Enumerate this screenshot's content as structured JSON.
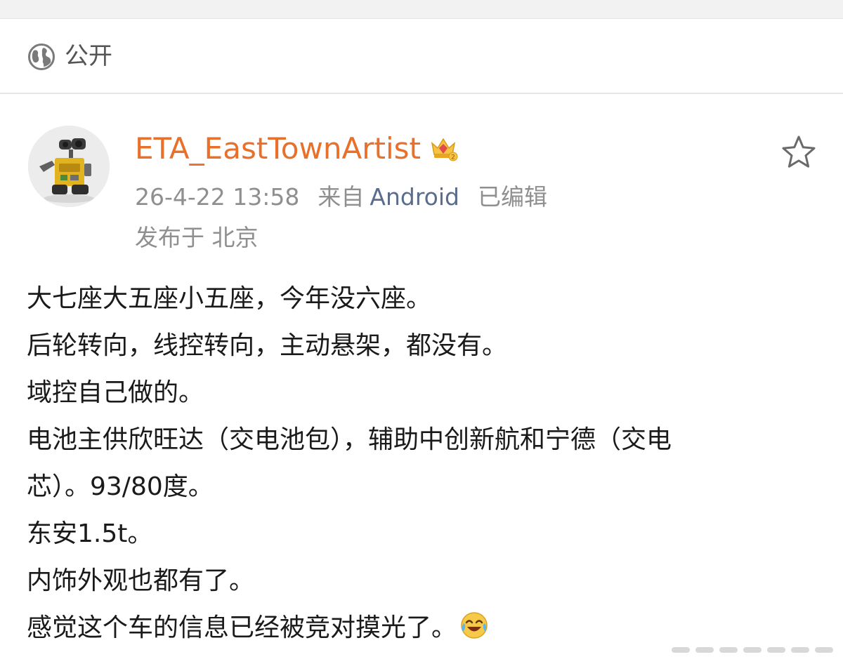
{
  "visibility": {
    "icon": "globe-icon",
    "label": "公开"
  },
  "post": {
    "author": {
      "name": "ETA_EastTownArtist",
      "avatar": "avatar-robot-image",
      "badge_icon": "vip-crown-icon"
    },
    "timestamp": "26-4-22 13:58",
    "source_prefix": "来自",
    "source_app": "Android",
    "edited_label": "已编辑",
    "location": "发布于 北京",
    "favorite_icon": "star-icon",
    "content": {
      "lines": [
        "大七座大五座小五座，今年没六座。",
        "后轮转向，线控转向，主动悬架，都没有。",
        "域控自己做的。",
        "电池主供欣旺达（交电池包），辅助中创新航和宁德（交电",
        "芯）。93/80度。",
        "东安1.5t。",
        "内饰外观也都有了。",
        "感觉这个车的信息已经被竞对摸光了。"
      ],
      "trailing_emoji": "laugh-cry-emoji-icon"
    }
  },
  "colors": {
    "username": "#e8702a",
    "source_app": "#5a6e8c",
    "meta_text": "#8f8f8f",
    "body_text": "#1a1a1a"
  }
}
